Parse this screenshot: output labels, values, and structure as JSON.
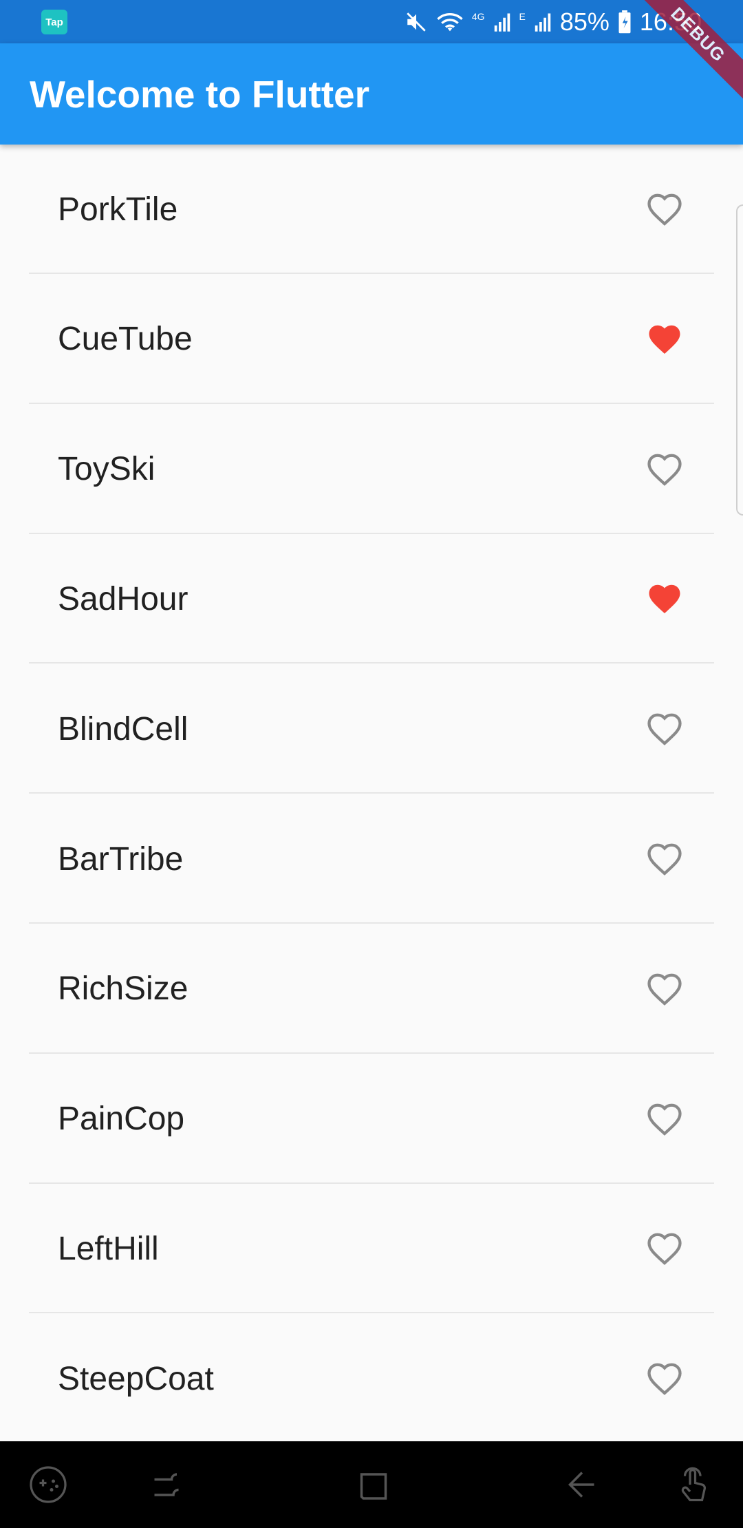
{
  "status_bar": {
    "app_icon_label": "Tap",
    "battery": "85%",
    "time": "16:50",
    "network_4g": "4G",
    "network_e": "E"
  },
  "app_bar": {
    "title": "Welcome to Flutter"
  },
  "debug_banner": "DEBUG",
  "words": [
    {
      "label": "PorkTile",
      "favorite": false
    },
    {
      "label": "CueTube",
      "favorite": true
    },
    {
      "label": "ToySki",
      "favorite": false
    },
    {
      "label": "SadHour",
      "favorite": true
    },
    {
      "label": "BlindCell",
      "favorite": false
    },
    {
      "label": "BarTribe",
      "favorite": false
    },
    {
      "label": "RichSize",
      "favorite": false
    },
    {
      "label": "PainCop",
      "favorite": false
    },
    {
      "label": "LeftHill",
      "favorite": false
    },
    {
      "label": "SteepCoat",
      "favorite": false
    }
  ],
  "colors": {
    "status_bar": "#1976d2",
    "app_bar": "#2196f3",
    "favorite_heart": "#f44336",
    "empty_heart": "#8a8a8a"
  },
  "nav_bar": {
    "icons": [
      "game-tools-icon",
      "recent-apps-icon",
      "home-icon",
      "back-icon",
      "touch-gesture-icon"
    ]
  }
}
